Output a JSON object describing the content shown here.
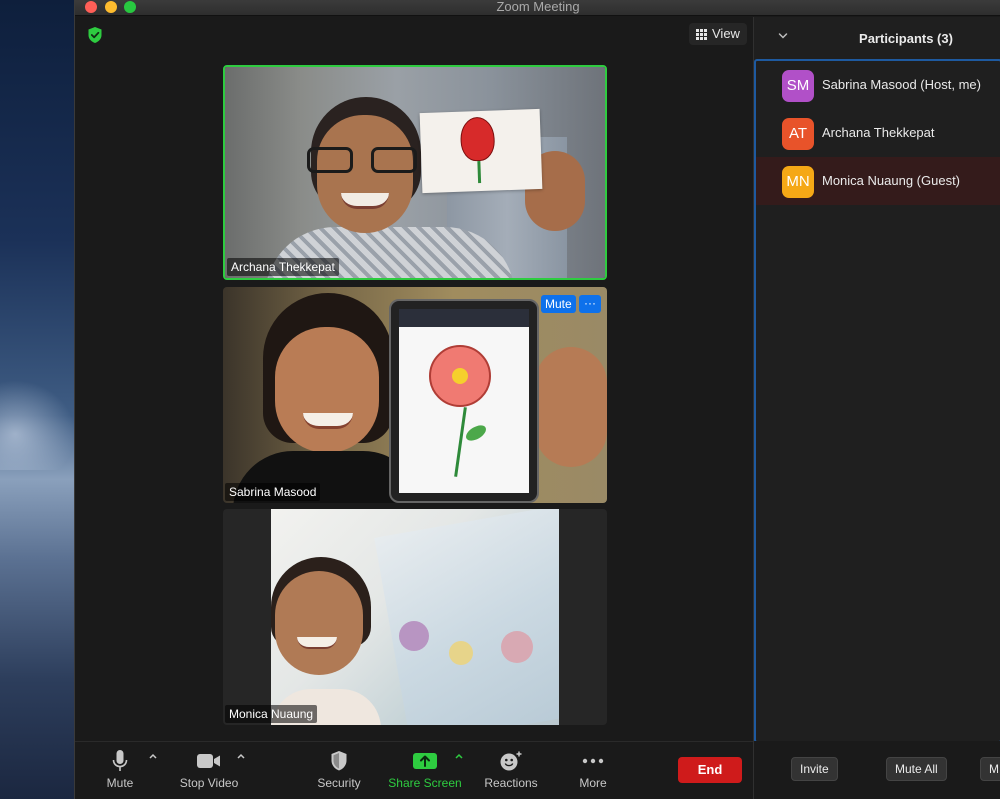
{
  "window": {
    "title": "Zoom Meeting"
  },
  "view_button": {
    "label": "View",
    "icon": "grid-icon"
  },
  "security_indicator": {
    "icon": "shield-check-icon",
    "color": "#2ecc40"
  },
  "videos": [
    {
      "name": "Archana Thekkepat",
      "active_speaker": true,
      "highlight_color": "#2ecc40"
    },
    {
      "name": "Sabrina Masood",
      "hover_controls": {
        "mute_label": "Mute",
        "more_label": "···"
      }
    },
    {
      "name": "Monica Nuaung"
    }
  ],
  "participants": {
    "title": "Participants (3)",
    "list": [
      {
        "initials": "SM",
        "name": "Sabrina Masood (Host, me)",
        "avatar_color": "#b150c8",
        "selected": false
      },
      {
        "initials": "AT",
        "name": "Archana Thekkepat",
        "avatar_color": "#e8532a",
        "selected": false
      },
      {
        "initials": "MN",
        "name": "Monica Nuaung (Guest)",
        "avatar_color": "#f5a816",
        "selected": true
      }
    ],
    "buttons": {
      "invite": "Invite",
      "mute_all": "Mute All",
      "more": "M"
    }
  },
  "toolbar": {
    "mute": "Mute",
    "stop_video": "Stop Video",
    "security": "Security",
    "share_screen": "Share Screen",
    "reactions": "Reactions",
    "more": "More",
    "end": "End",
    "share_color": "#2ecc40",
    "end_color": "#cf1b1b"
  }
}
